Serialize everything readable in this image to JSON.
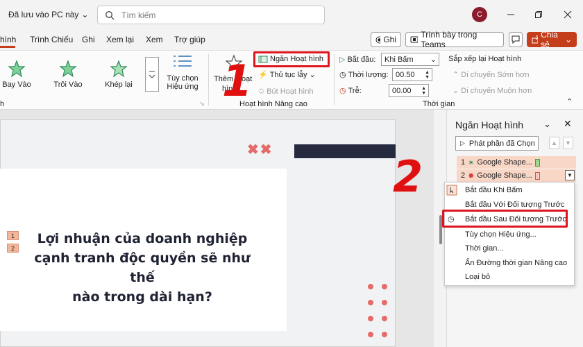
{
  "title_bar": {
    "doc_status": "Đã lưu vào PC này",
    "search_placeholder": "Tìm kiếm",
    "avatar_letter": "C"
  },
  "tabs": {
    "active": "hình",
    "items": [
      "Trình Chiếu",
      "Ghi",
      "Xem lại",
      "Xem",
      "Trợ giúp"
    ]
  },
  "tab_buttons": {
    "record": "Ghi",
    "teams": "Trình bày trong Teams",
    "share": "Chia sẻ"
  },
  "ribbon": {
    "animations": [
      "Bay Vào",
      "Trôi Vào",
      "Khép lại"
    ],
    "effect_options": [
      "Tùy chọn",
      "Hiệu ứng"
    ],
    "add_animation": [
      "Thêm",
      "hình"
    ],
    "add_animation_partial": "oạt",
    "advanced": {
      "pane": "Ngăn Hoạt hình",
      "trigger": "Thủ tục lẫy",
      "painter": "Bút Hoạt hình",
      "group": "Hoạt hình Nâng cao",
      "left_group": "h"
    },
    "timing": {
      "start_label": "Bắt đầu:",
      "start_value": "Khi Bấm",
      "duration_label": "Thời lượng:",
      "duration_value": "00.50",
      "delay_label": "Trễ:",
      "delay_value": "00.00",
      "group": "Thời gian"
    },
    "reorder": {
      "title": "Sắp xếp lại Hoạt hình",
      "earlier": "Di chuyển Sớm hơn",
      "later": "Di chuyển Muộn hơn"
    }
  },
  "slide": {
    "title_lines": [
      "Lợi nhuận của doanh nghiệp",
      "cạnh tranh độc quyền sẽ như thế",
      "nào trong dài hạn?"
    ],
    "tags": [
      "1",
      "2"
    ],
    "marks": "✖✖"
  },
  "callouts": {
    "one": "1",
    "two": "2"
  },
  "pane": {
    "title": "Ngăn Hoạt hình",
    "play": "Phát phần đã Chọn",
    "items": [
      {
        "num": "1",
        "name": "Google Shape..."
      },
      {
        "num": "2",
        "name": "Google Shape..."
      }
    ]
  },
  "menu": {
    "items": [
      "Bắt đầu Khi Bấm",
      "Bắt đầu Với Đối tượng Trước",
      "Bắt đầu Sau Đối tượng Trước",
      "Tùy chọn Hiệu ứng...",
      "Thời gian...",
      "Ẩn Đường thời gian Nâng cao",
      "Loại bỏ"
    ]
  },
  "colors": {
    "accent": "#c43e1c",
    "callout_red": "#e01010",
    "item_bg": "#f9d7c7",
    "slide_dark": "#262a3f",
    "dots": "#e56b6b"
  }
}
